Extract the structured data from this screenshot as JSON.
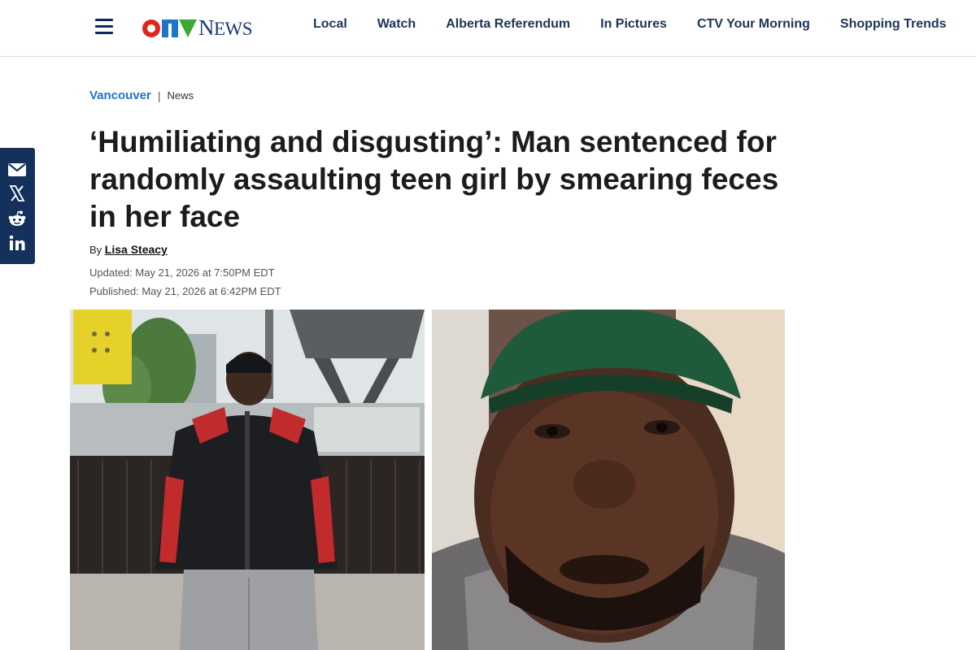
{
  "header": {
    "logo_text": "NEWS",
    "logo_prefix": "CTV",
    "nav": [
      "Local",
      "Watch",
      "Alberta Referendum",
      "In Pictures",
      "CTV Your Morning",
      "Shopping Trends"
    ]
  },
  "share": {
    "icons": [
      "email-icon",
      "x-icon",
      "reddit-icon",
      "linkedin-icon"
    ]
  },
  "article": {
    "region": "Vancouver",
    "section": "News",
    "separator": "|",
    "headline": "‘Humiliating and disgusting’: Man sentenced for randomly assaulting teen girl by smearing feces in her face",
    "by_label": "By",
    "author": "Lisa Steacy",
    "updated": "Updated: May 21, 2026 at 7:50PM EDT",
    "published": "Published: May 21, 2026 at 6:42PM EDT"
  },
  "colors": {
    "nav_text": "#1d3557",
    "region_link": "#1f74c9",
    "share_rail": "#14315c",
    "logo_red": "#e0251b",
    "logo_blue": "#1f74c9",
    "logo_green": "#3aa935"
  }
}
